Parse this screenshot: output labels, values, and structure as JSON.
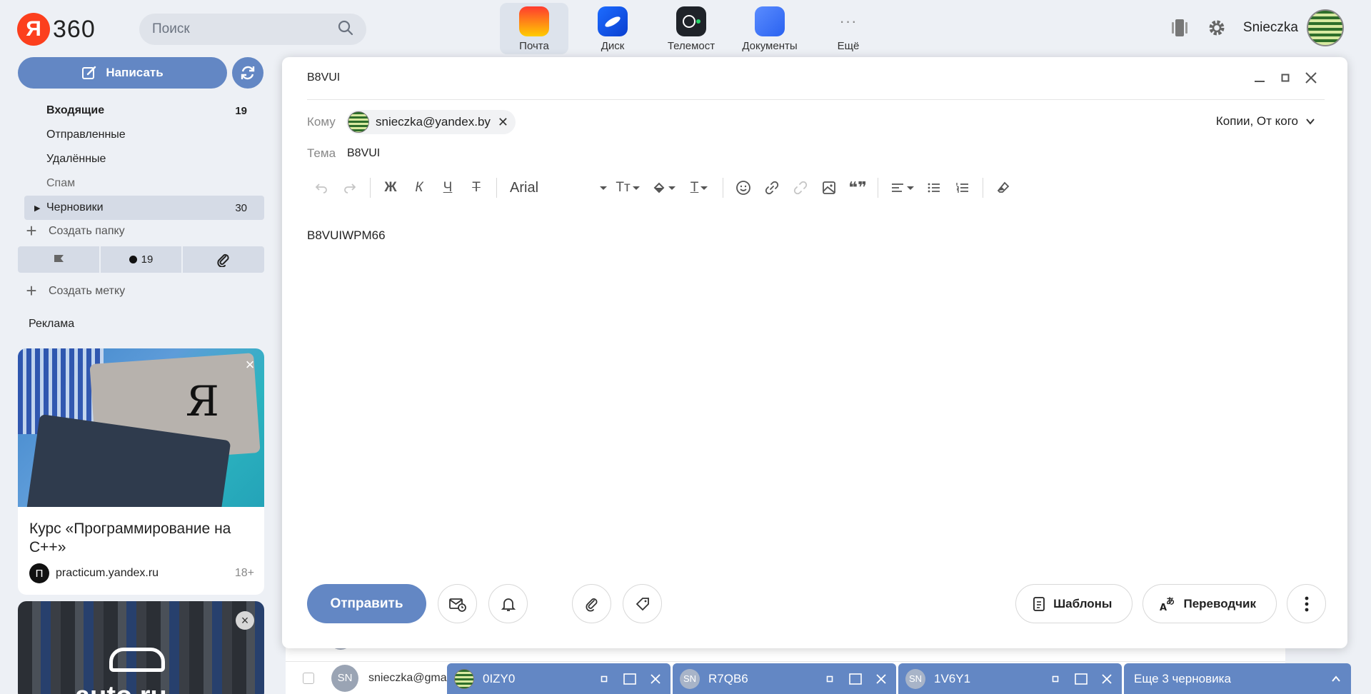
{
  "header": {
    "logo_letter": "Я",
    "logo_text": "360",
    "search_placeholder": "Поиск",
    "services": [
      {
        "label": "Почта",
        "icon": "mail-icon"
      },
      {
        "label": "Диск",
        "icon": "disk-icon"
      },
      {
        "label": "Телемост",
        "icon": "telemost-icon"
      },
      {
        "label": "Документы",
        "icon": "docs-icon"
      },
      {
        "label": "Ещё",
        "icon": "more-icon"
      }
    ],
    "user_name": "Snieczka"
  },
  "sidebar": {
    "compose_label": "Написать",
    "folders": [
      {
        "label": "Входящие",
        "count": "19"
      },
      {
        "label": "Отправленные",
        "count": ""
      },
      {
        "label": "Удалённые",
        "count": ""
      },
      {
        "label": "Спам",
        "count": ""
      },
      {
        "label": "Черновики",
        "count": "30"
      }
    ],
    "create_folder": "Создать папку",
    "labels": {
      "unread_count": "19"
    },
    "create_label": "Создать метку",
    "ads_title": "Реклама",
    "ad": {
      "text": "Курс «Программирование на С++»",
      "domain": "practicum.yandex.ru",
      "domain_icon": "П",
      "age": "18+"
    },
    "ad2_brand": "auto.ru"
  },
  "compose": {
    "title": "B8VUI",
    "to_label": "Кому",
    "recipient": "snieczka@yandex.by",
    "copies_label": "Копии, От кого",
    "subject_label": "Тема",
    "subject": "B8VUI",
    "toolbar": {
      "bold": "Ж",
      "italic": "К",
      "underline": "Ч",
      "strike": "Т",
      "font": "Arial",
      "text_size": "Тт",
      "text_color": "Т"
    },
    "body": "B8VUIWPM66",
    "send_label": "Отправить",
    "templates_label": "Шаблоны",
    "translator_label": "Переводчик"
  },
  "list_background": {
    "row_avatar": "SN",
    "row_from": "snieczka@gmail"
  },
  "drafts": [
    {
      "title": "0IZY0",
      "avatar": ""
    },
    {
      "title": "R7QB6",
      "avatar": "SN"
    },
    {
      "title": "1V6Y1",
      "avatar": "SN"
    }
  ],
  "more_drafts_label": "Еще 3 черновика",
  "colors": {
    "accent": "#6387c4",
    "yandex_red": "#fc3f1d"
  }
}
